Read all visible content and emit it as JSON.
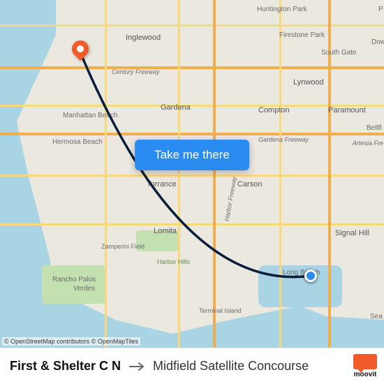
{
  "map": {
    "cta_label": "Take me there",
    "attribution": {
      "osm": "© OpenStreetMap contributors",
      "tiles": "© OpenMapTiles"
    },
    "labels": {
      "huntington_park": "Huntington Park",
      "inglewood": "Inglewood",
      "firestone_park": "Firestone Park",
      "south_gate": "South Gate",
      "down": "Down",
      "century_fwy": "Century Freeway",
      "lynwood": "Lynwood",
      "gardena": "Gardena",
      "compton": "Compton",
      "paramount": "Paramount",
      "manhattan_beach": "Manhattan Beach",
      "bellflower": "Bellfl",
      "hermosa_beach": "Hermosa Beach",
      "gardena_fwy": "Gardena Freeway",
      "artesia_fwy": "Artesia Fre",
      "torrance": "Torrance",
      "carson": "Carson",
      "harbor_fwy": "Harbor Freeway",
      "lomita": "Lomita",
      "signal_hill": "Signal Hill",
      "zamperini": "Zamperini Field",
      "harbor_hills": "Harbor Hills",
      "rancho_pv": "Rancho Palos",
      "verdes": "Verdes",
      "long_beach": "Long Beach",
      "terminal_island": "Terminal Island",
      "sea": "Sea",
      "p": "P"
    }
  },
  "footer": {
    "from": "First & Shelter C N",
    "to": "Midfield Satellite Concourse",
    "brand": "moovit"
  }
}
